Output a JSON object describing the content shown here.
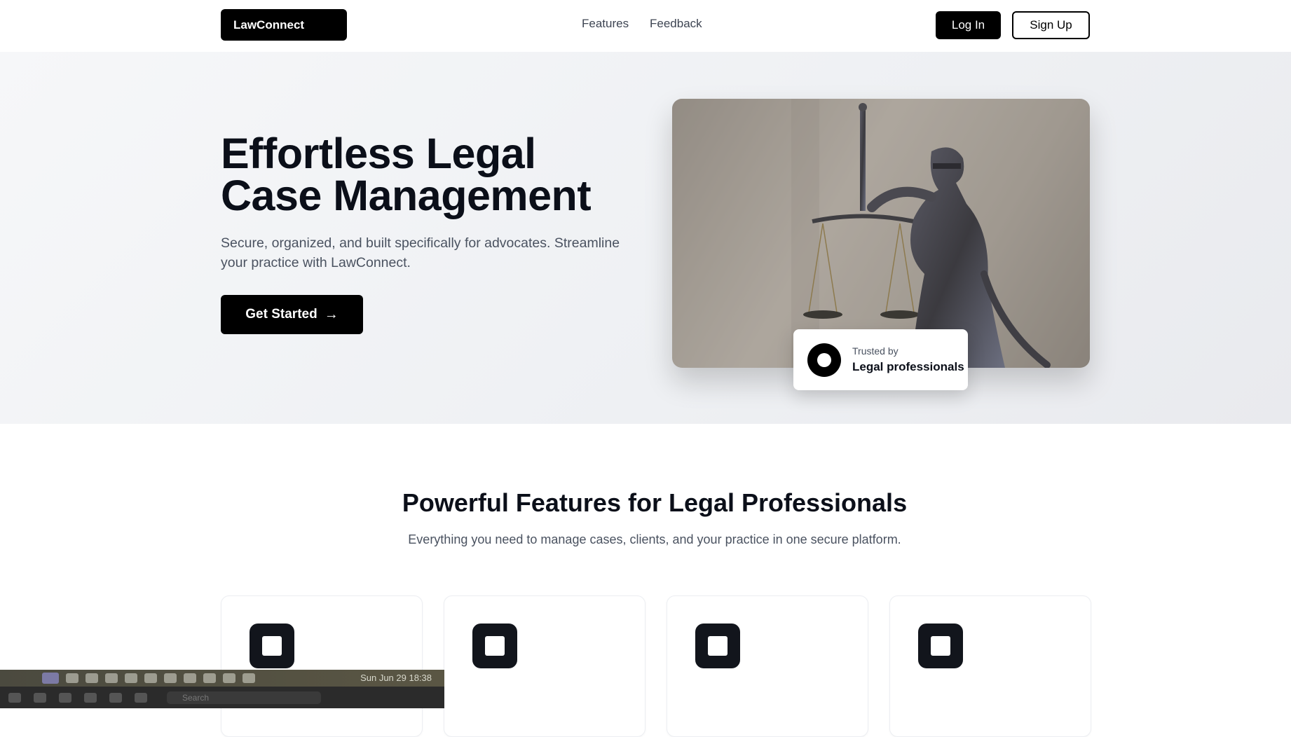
{
  "nav": {
    "logo": "LawConnect",
    "links": [
      "Features",
      "Feedback"
    ],
    "login": "Log In",
    "signup": "Sign Up"
  },
  "hero": {
    "title_line1": "Effortless Legal",
    "title_line2": "Case Management",
    "subtitle": "Secure, organized, and built specifically for advocates. Streamline your practice with LawConnect.",
    "cta": "Get Started",
    "trust_top": "Trusted by",
    "trust_bottom": "Legal professionals"
  },
  "features": {
    "title": "Powerful Features for Legal Professionals",
    "subtitle": "Everything you need to manage cases, clients, and your practice in one secure platform."
  },
  "taskbar": {
    "datetime": "Sun Jun 29  18:38",
    "search_placeholder": "Search"
  },
  "icons": {
    "cta_arrow": "arrow-right-icon",
    "trust": "ring-icon",
    "card": "square-icon"
  }
}
